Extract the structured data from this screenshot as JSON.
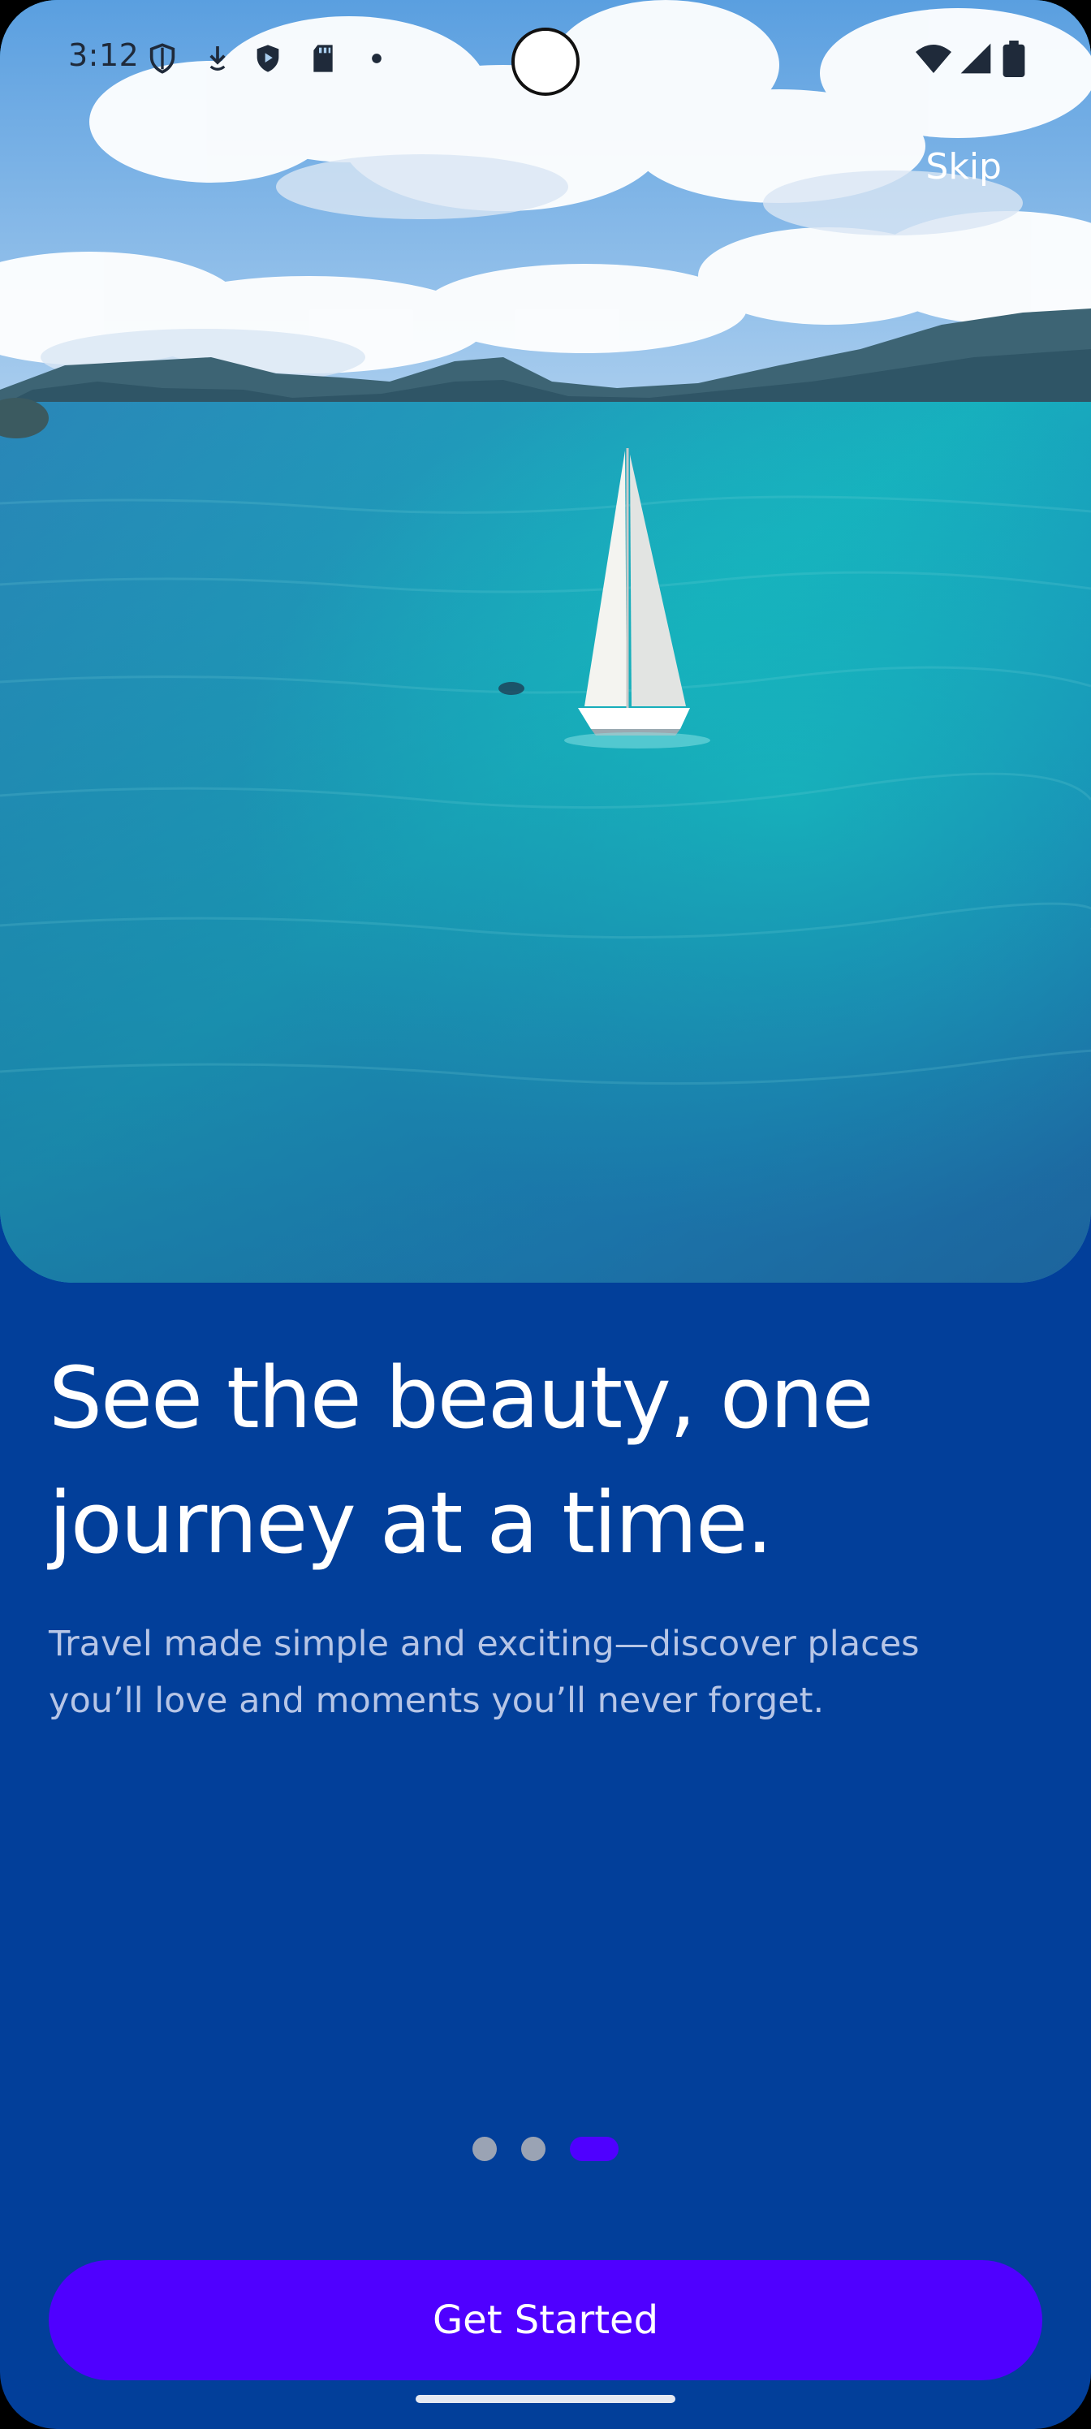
{
  "status_bar": {
    "time": "3:12",
    "icons": [
      "shield-outline-icon",
      "download-icon",
      "shield-play-icon",
      "sd-card-icon",
      "dot-icon",
      "wifi-icon",
      "cellular-signal-icon",
      "battery-icon"
    ]
  },
  "header": {
    "skip_label": "Skip"
  },
  "hero": {
    "image": "sailboat-on-turquoise-sea"
  },
  "content": {
    "headline_line1": "See the beauty, one",
    "headline_line2": "journey at a time.",
    "subtext_line1": "Travel made simple and exciting—discover places",
    "subtext_line2": "you’ll love and moments you’ll never forget."
  },
  "pager": {
    "total": 3,
    "active_index": 3
  },
  "cta": {
    "label": "Get Started"
  },
  "colors": {
    "background": "#023F9A",
    "accent": "#4F00FF",
    "subtext": "#B6C5E6",
    "inactive_dot": "#9AA3B4"
  }
}
